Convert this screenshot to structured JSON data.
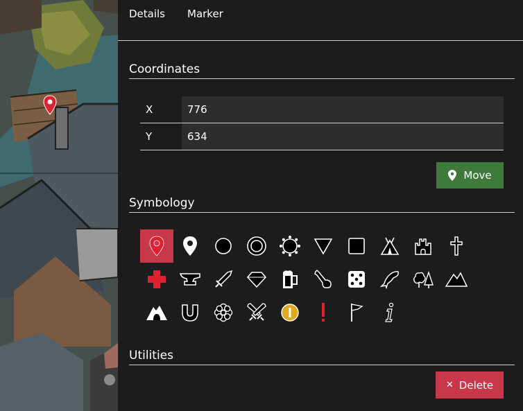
{
  "tabs": [
    {
      "label": "Details"
    },
    {
      "label": "Marker"
    }
  ],
  "coordinates": {
    "title": "Coordinates",
    "x_label": "X",
    "x_value": "776",
    "y_label": "Y",
    "y_value": "634",
    "move_label": "Move"
  },
  "symbology": {
    "title": "Symbology",
    "selected": "map-pin",
    "icons": [
      "map-pin",
      "map-pin-outline",
      "circle",
      "double-circle",
      "sun",
      "triangle-down",
      "square",
      "tent",
      "castle",
      "cross",
      "red-cross",
      "anvil",
      "sword",
      "diamond",
      "beer-mug",
      "meat-drumstick",
      "dice",
      "dolphin",
      "trees",
      "mountain",
      "cave",
      "magnet",
      "flower",
      "crossed-swords",
      "coin",
      "exclamation",
      "flag",
      "info"
    ]
  },
  "utilities": {
    "title": "Utilities",
    "delete_label": "Delete"
  },
  "colors": {
    "panel_bg": "#1c1c1c",
    "move_green": "#3d7a3b",
    "delete_red": "#c9374b",
    "selected_red": "#c9374b",
    "pin_red": "#e0202f"
  }
}
